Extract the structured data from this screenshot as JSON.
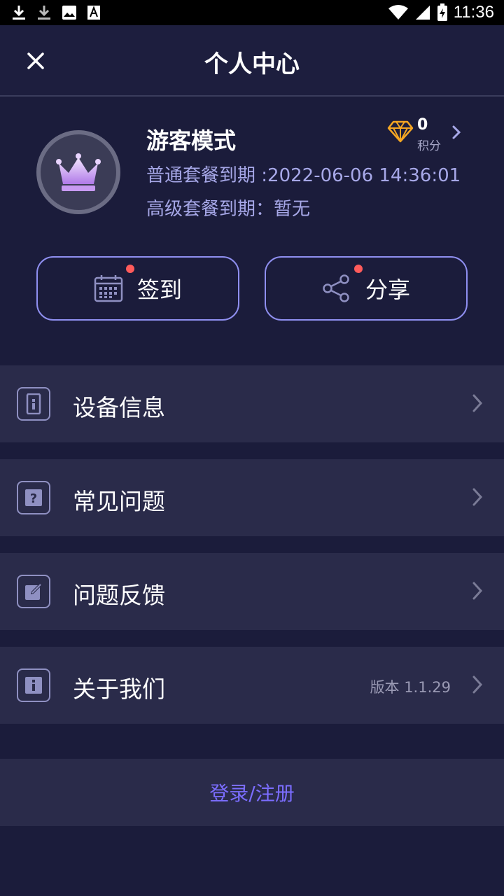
{
  "status_bar": {
    "time": "11:36",
    "icons": [
      "download-icon",
      "download-icon",
      "image-icon",
      "text-icon",
      "wifi-icon",
      "signal-icon",
      "battery-charging-icon"
    ]
  },
  "header": {
    "title": "个人中心",
    "close_icon": "close-icon"
  },
  "profile": {
    "name": "游客模式",
    "normal_plan": "普通套餐到期 :2022-06-06 14:36:01",
    "premium_plan": "高级套餐到期：暂无",
    "points_value": "0",
    "points_label": "积分",
    "avatar_icon": "crown-icon"
  },
  "actions": {
    "checkin_label": "签到",
    "share_label": "分享"
  },
  "menu": [
    {
      "label": "设备信息",
      "icon": "device-info-icon"
    },
    {
      "label": "常见问题",
      "icon": "question-icon"
    },
    {
      "label": "问题反馈",
      "icon": "edit-icon"
    },
    {
      "label": "关于我们",
      "icon": "info-icon",
      "version": "版本  1.1.29"
    }
  ],
  "login": {
    "label": "登录/注册"
  },
  "colors": {
    "background": "#1b1c3b",
    "panel": "#2a2b4a",
    "accent": "#7b6dff",
    "subtext": "#a7a8e8",
    "badge": "#ff5b5b",
    "diamond": "#f5a623"
  }
}
